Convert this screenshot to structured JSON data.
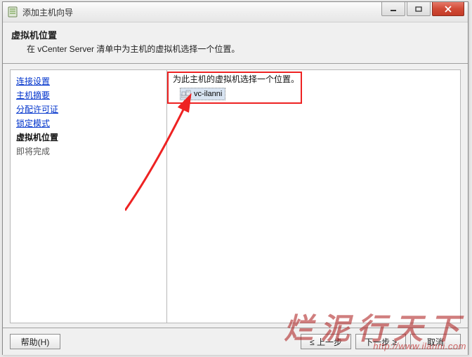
{
  "window": {
    "title": "添加主机向导"
  },
  "header": {
    "title": "虚拟机位置",
    "subtitle": "在 vCenter Server 清单中为主机的虚拟机选择一个位置。"
  },
  "nav": {
    "items": [
      {
        "label": "连接设置",
        "kind": "link"
      },
      {
        "label": "主机摘要",
        "kind": "link"
      },
      {
        "label": "分配许可证",
        "kind": "link"
      },
      {
        "label": "锁定模式",
        "kind": "link"
      },
      {
        "label": "虚拟机位置",
        "kind": "current"
      },
      {
        "label": "即将完成",
        "kind": "plain"
      }
    ]
  },
  "main": {
    "prompt": "为此主机的虚拟机选择一个位置。",
    "tree": {
      "node_label": "vc-ilanni"
    }
  },
  "footer": {
    "help": "帮助(H)",
    "back": "≤ 上一步",
    "next": "下一步 ≥",
    "cancel": "取消"
  },
  "watermark": {
    "cn": "烂泥行天下",
    "url": "http://www.ilanni.com"
  }
}
